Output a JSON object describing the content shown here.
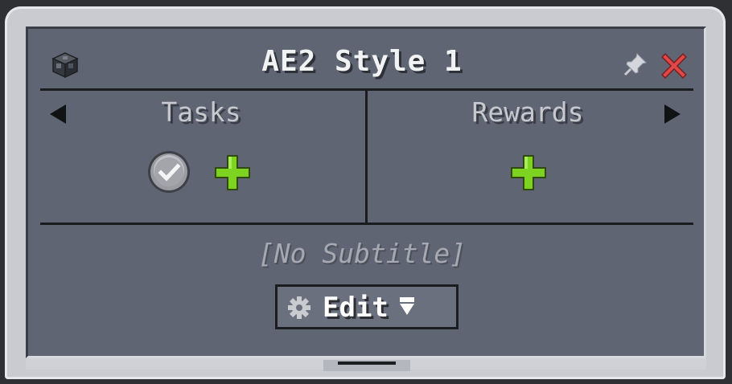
{
  "dialog": {
    "title": "AE2 Style 1",
    "subtitle": "[No Subtitle]",
    "icon": "ae2-block-icon"
  },
  "header": {
    "pin_icon": "pin-icon",
    "close_icon": "close-icon",
    "close_color": "#d83a3a"
  },
  "columns": {
    "tasks_label": "Tasks",
    "rewards_label": "Rewards"
  },
  "navigation": {
    "prev_icon": "triangle-left-icon",
    "next_icon": "triangle-right-icon"
  },
  "tasks": {
    "items": [
      {
        "icon": "checkmark-icon"
      }
    ],
    "add_icon": "plus-icon"
  },
  "rewards": {
    "items": [],
    "add_icon": "plus-icon"
  },
  "edit_button": {
    "label": "Edit",
    "icon": "gear-icon",
    "dropdown_icon": "dropdown-arrow-icon"
  },
  "colors": {
    "accent_green": "#7ed321",
    "panel": "#5f6573",
    "frame": "#c9cbd0"
  }
}
